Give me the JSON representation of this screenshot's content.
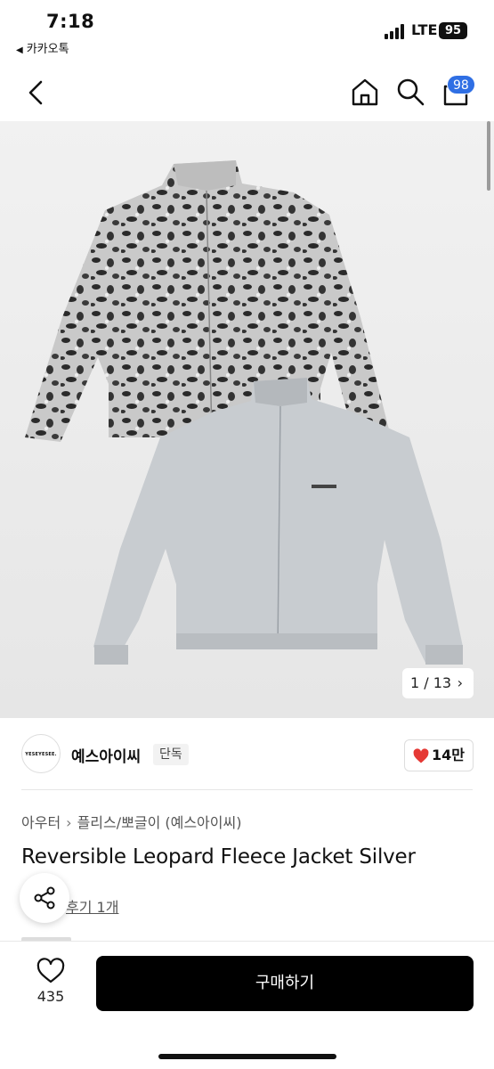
{
  "status": {
    "time": "7:18",
    "back_app": "카카오톡",
    "network": "LTE",
    "battery": "95"
  },
  "nav": {
    "cart_count": "98"
  },
  "image": {
    "counter": "1 / 13"
  },
  "seller": {
    "logo_text": "YESEYESEE.",
    "name": "예스아이씨",
    "badge": "단독",
    "likes": "14만"
  },
  "breadcrumb": {
    "category": "아우터",
    "subcategory": "플리스/뽀글이 (예스아이씨)"
  },
  "product": {
    "title": "Reversible Leopard Fleece Jacket Silver",
    "review_link": "후기 1개"
  },
  "bottom": {
    "wish_count": "435",
    "buy_label": "구매하기"
  },
  "colors": {
    "accent_blue": "#2f6fe4",
    "like_red": "#e53935",
    "buy_black": "#000000"
  }
}
